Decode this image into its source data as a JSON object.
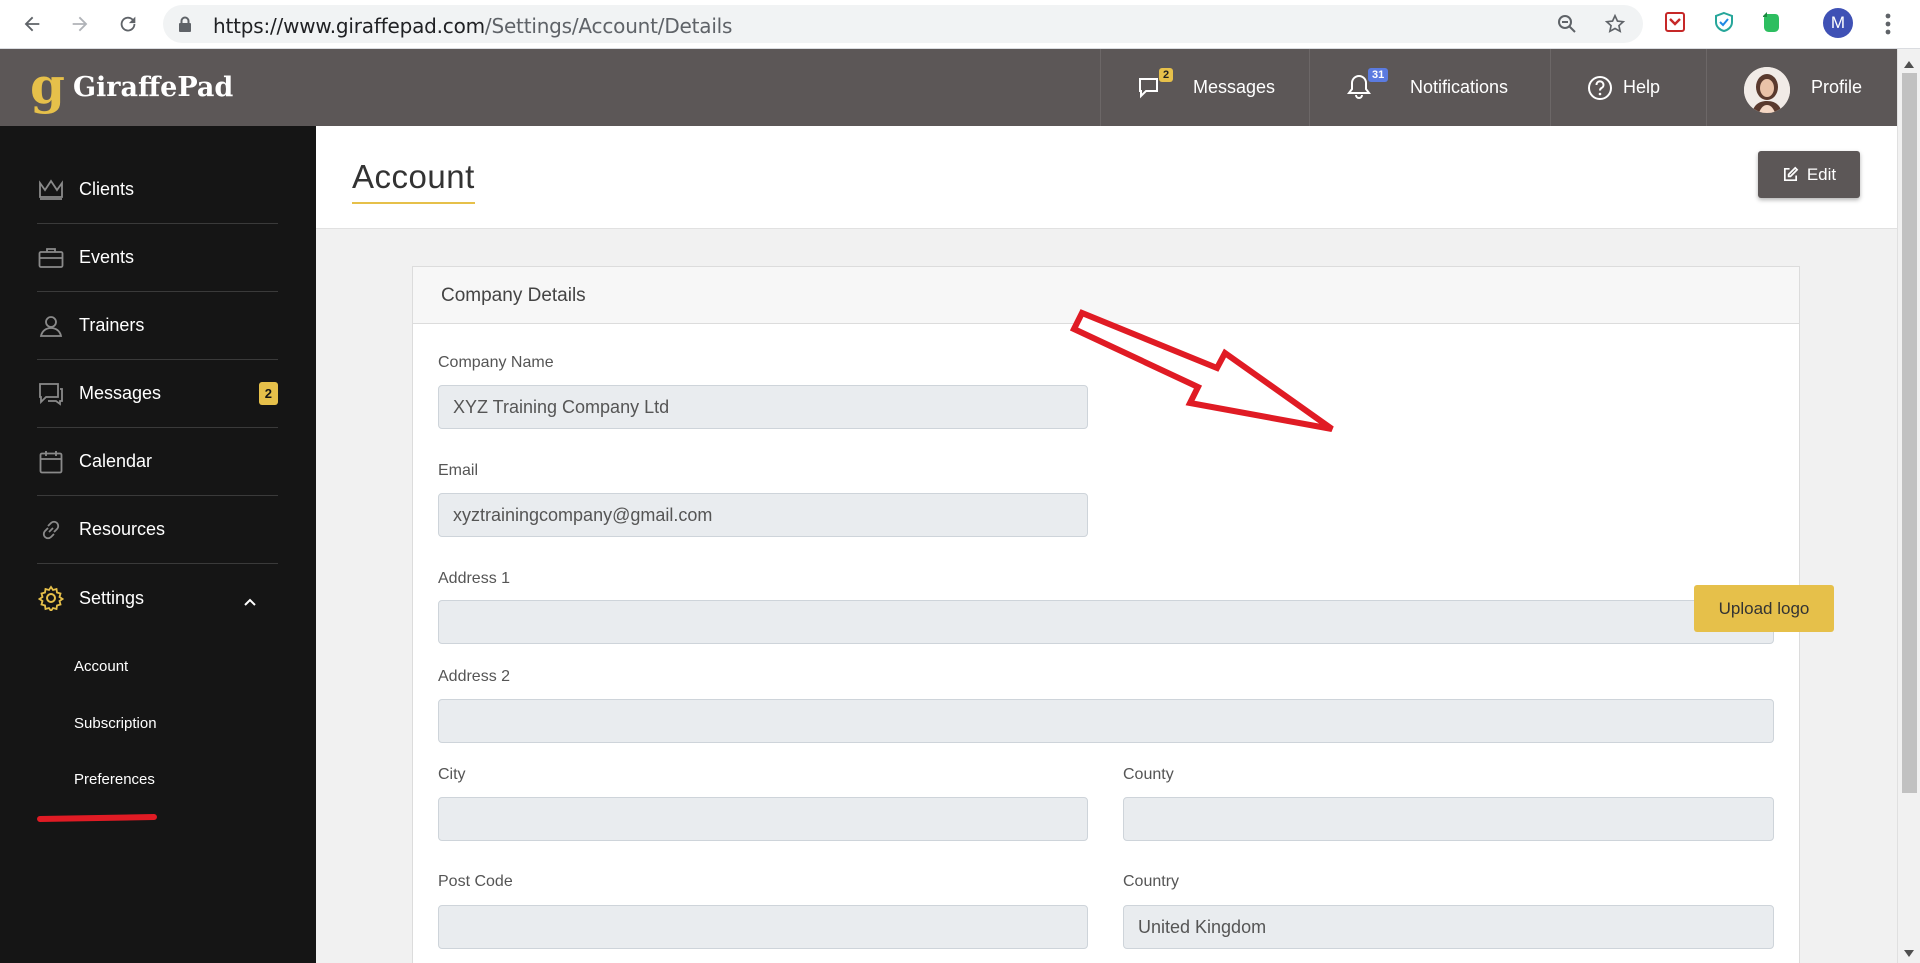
{
  "browser": {
    "url_host": "https://www.giraffepad.com",
    "url_path": "/Settings/Account/Details",
    "profile_initial": "M"
  },
  "header": {
    "logo_letter": "g",
    "logo_text": "GiraffePad",
    "messages_label": "Messages",
    "messages_count": "2",
    "notifications_label": "Notifications",
    "notifications_count": "31",
    "help_label": "Help",
    "profile_label": "Profile"
  },
  "sidebar": {
    "items": [
      {
        "label": "Clients",
        "icon": "crown-icon"
      },
      {
        "label": "Events",
        "icon": "briefcase-icon"
      },
      {
        "label": "Trainers",
        "icon": "user-icon"
      },
      {
        "label": "Messages",
        "icon": "chat-icon",
        "badge": "2"
      },
      {
        "label": "Calendar",
        "icon": "calendar-icon"
      },
      {
        "label": "Resources",
        "icon": "link-icon"
      },
      {
        "label": "Settings",
        "icon": "gear-icon"
      }
    ],
    "sub_items": [
      "Account",
      "Subscription",
      "Preferences"
    ]
  },
  "page": {
    "title": "Account",
    "edit_label": "Edit"
  },
  "card": {
    "title": "Company Details",
    "upload_label": "Upload logo",
    "fields": {
      "company_name": {
        "label": "Company Name",
        "value": "XYZ Training Company Ltd"
      },
      "email": {
        "label": "Email",
        "value": "xyztrainingcompany@gmail.com"
      },
      "address1": {
        "label": "Address 1",
        "value": ""
      },
      "address2": {
        "label": "Address 2",
        "value": ""
      },
      "city": {
        "label": "City",
        "value": ""
      },
      "county": {
        "label": "County",
        "value": ""
      },
      "post_code": {
        "label": "Post Code",
        "value": ""
      },
      "country": {
        "label": "Country",
        "value": "United Kingdom"
      }
    }
  },
  "colors": {
    "accent": "#e6c04a",
    "header_bg": "#5c5757",
    "sidebar_bg": "#151515",
    "annotation_red": "#e01b24",
    "notif_badge": "#5b7be0"
  }
}
